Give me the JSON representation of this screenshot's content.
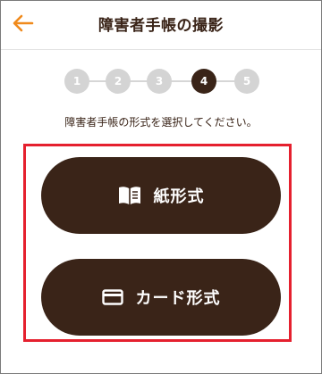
{
  "header": {
    "title": "障害者手帳の撮影",
    "back_icon": "arrow-left-icon",
    "accent_color": "#f08a1c"
  },
  "stepper": {
    "steps": [
      "1",
      "2",
      "3",
      "4",
      "5"
    ],
    "current": "4",
    "active_color": "#3a2418",
    "inactive_color": "#d4d4d4"
  },
  "instruction": "障害者手帳の形式を選択してください。",
  "options": {
    "paper": {
      "label": "紙形式",
      "icon": "open-book-icon"
    },
    "card": {
      "label": "カード形式",
      "icon": "card-icon"
    }
  },
  "colors": {
    "button_bg": "#3a2418",
    "highlight_border": "#e5202e"
  }
}
